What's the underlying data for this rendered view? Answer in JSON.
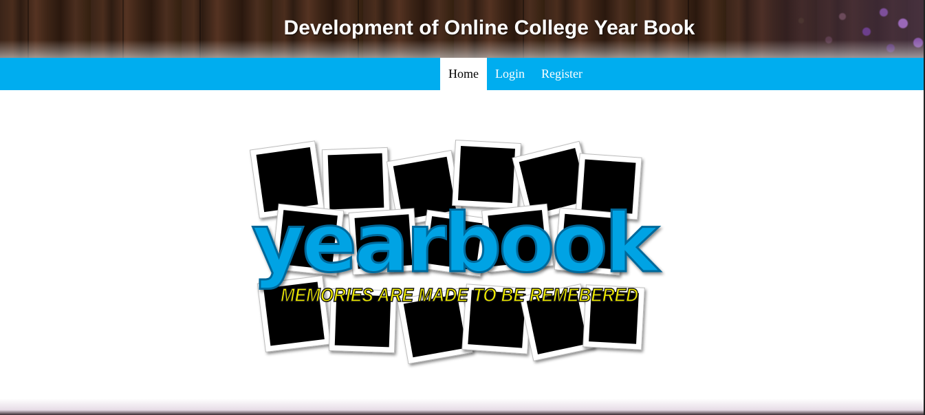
{
  "header": {
    "title": "Development of Online College Year Book"
  },
  "nav": {
    "items": [
      {
        "label": "Home",
        "active": true
      },
      {
        "label": "Login",
        "active": false
      },
      {
        "label": "Register",
        "active": false
      }
    ]
  },
  "hero": {
    "logo_word": "yearbook",
    "logo_tagline": "MEMORIES ARE MADE TO BE REMEBERED"
  },
  "colors": {
    "nav_bg": "#00adef",
    "logo_blue": "#00a3e4",
    "tagline_yellow": "#f2ee00",
    "header_wood": "#3a2418"
  },
  "icons": [
    "flower-decoration-image"
  ]
}
